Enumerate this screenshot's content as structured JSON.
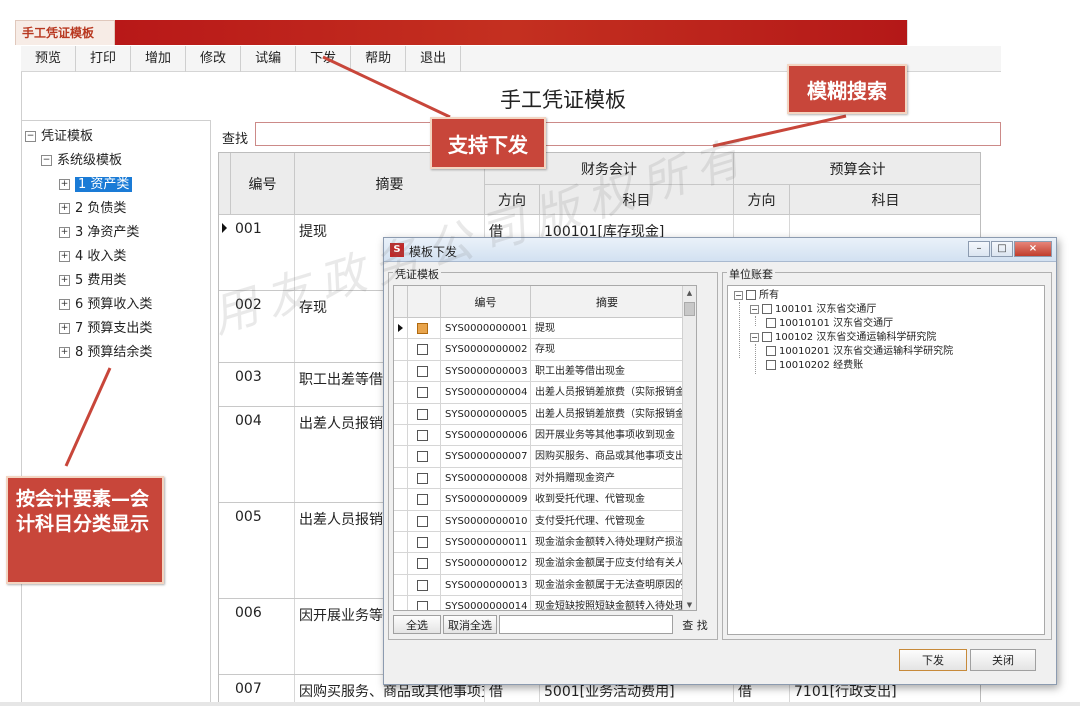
{
  "app": {
    "title": "手工凭证模板"
  },
  "toolbar": {
    "items": [
      "预览",
      "打印",
      "增加",
      "修改",
      "试编",
      "下发",
      "帮助",
      "退出"
    ]
  },
  "page": {
    "title": "手工凭证模板"
  },
  "search": {
    "label": "查找",
    "value": ""
  },
  "tree": {
    "root": "凭证模板",
    "level1": "系统级模板",
    "items": [
      "1 资产类",
      "2 负债类",
      "3 净资产类",
      "4 收入类",
      "5 费用类",
      "6 预算收入类",
      "7 预算支出类",
      "8 预算结余类"
    ]
  },
  "grid": {
    "headers": {
      "code": "编号",
      "summary": "摘要",
      "finance": "财务会计",
      "budget": "预算会计",
      "direction": "方向",
      "subject": "科目"
    },
    "rows": [
      {
        "code": "001",
        "summary": "提现",
        "fin_dir": "借",
        "fin_subject": "100101[库存现金]",
        "bud_dir": "",
        "bud_subject": ""
      },
      {
        "code": "002",
        "summary": "存现",
        "fin_dir": "",
        "fin_subject": "",
        "bud_dir": "",
        "bud_subject": ""
      },
      {
        "code": "003",
        "summary": "职工出差等借出",
        "fin_dir": "",
        "fin_subject": "",
        "bud_dir": "",
        "bud_subject": ""
      },
      {
        "code": "004",
        "summary": "出差人员报销差",
        "fin_dir": "",
        "fin_subject": "",
        "bud_dir": "",
        "bud_subject": ""
      },
      {
        "code": "005",
        "summary": "出差人员报销差",
        "fin_dir": "",
        "fin_subject": "",
        "bud_dir": "",
        "bud_subject": ""
      },
      {
        "code": "006",
        "summary": "因开展业务等其",
        "fin_dir": "",
        "fin_subject": "",
        "bud_dir": "",
        "bud_subject": ""
      },
      {
        "code": "007",
        "summary": "因购买服务、商品或其他事项支出",
        "fin_dir": "借",
        "fin_subject": "5001[业务活动费用]",
        "bud_dir": "借",
        "bud_subject": "7101[行政支出]"
      }
    ]
  },
  "dialog": {
    "title": "模板下发",
    "left_group": "凭证模板",
    "right_group": "单位账套",
    "columns": {
      "code": "编号",
      "summary": "摘要"
    },
    "rows": [
      {
        "code": "SYS0000000001",
        "summary": "提现"
      },
      {
        "code": "SYS0000000002",
        "summary": "存现"
      },
      {
        "code": "SYS0000000003",
        "summary": "职工出差等借出现金"
      },
      {
        "code": "SYS0000000004",
        "summary": "出差人员报销差旅费（实际报销金额"
      },
      {
        "code": "SYS0000000005",
        "summary": "出差人员报销差旅费（实际报销金额"
      },
      {
        "code": "SYS0000000006",
        "summary": "因开展业务等其他事项收到现金"
      },
      {
        "code": "SYS0000000007",
        "summary": "因购买服务、商品或其他事项支出现"
      },
      {
        "code": "SYS0000000008",
        "summary": "对外捐赠现金资产"
      },
      {
        "code": "SYS0000000009",
        "summary": "收到受托代理、代管现金"
      },
      {
        "code": "SYS0000000010",
        "summary": "支付受托代理、代管现金"
      },
      {
        "code": "SYS0000000011",
        "summary": "现金溢余金额转入待处理财产损溢"
      },
      {
        "code": "SYS0000000012",
        "summary": "现金溢余金额属于应支付给有关人员"
      },
      {
        "code": "SYS0000000013",
        "summary": "现金溢余金额属于无法查明原因的部"
      },
      {
        "code": "SYS0000000014",
        "summary": "现金短缺按照短缺金额转入待处理财"
      }
    ],
    "select_all": "全选",
    "deselect_all": "取消全选",
    "find": "查 找",
    "issue_button": "下发",
    "close_button": "关闭",
    "accounts": {
      "root": "所有",
      "items": [
        {
          "label": "100101 汉东省交通厅",
          "level": 1
        },
        {
          "label": "10010101 汉东省交通厅",
          "level": 2
        },
        {
          "label": "100102 汉东省交通运输科学研究院",
          "level": 1
        },
        {
          "label": "10010201 汉东省交通运输科学研究院",
          "level": 2
        },
        {
          "label": "10010202 经费账",
          "level": 2
        }
      ]
    }
  },
  "callouts": {
    "fuzzy": "模糊搜索",
    "issue": "支持下发",
    "classify": "按会计要素—会计科目分类显示"
  },
  "watermark": "用友政务公司版权所有",
  "colors": {
    "accent": "#c8463a",
    "selection": "#1a7bd6",
    "title_strip": "#b81818"
  }
}
